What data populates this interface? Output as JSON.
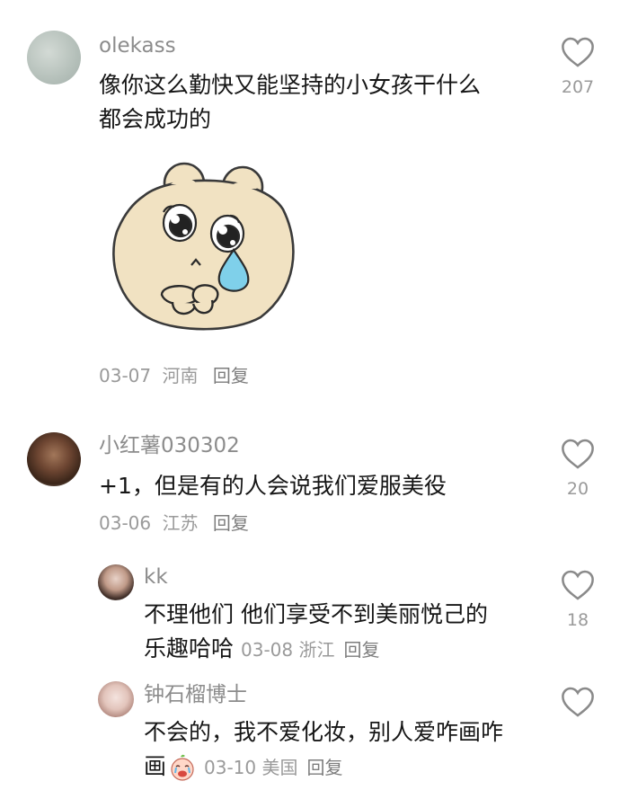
{
  "comments": [
    {
      "user": "olekass",
      "text_line1": "像你这么勤快又能坚持的小女孩干什么",
      "text_line2": "都会成功的",
      "date": "03-07",
      "location": "河南",
      "reply_label": "回复",
      "likes": "207",
      "sticker": "crying-bear-sticker"
    },
    {
      "user": "小红薯030302",
      "text": "+1，但是有的人会说我们爱服美役",
      "date": "03-06",
      "location": "江苏",
      "reply_label": "回复",
      "likes": "20"
    }
  ],
  "replies": [
    {
      "user": "kk",
      "text_line1": "不理他们 他们享受不到美丽悦己的",
      "text_line2": "乐趣哈哈",
      "date": "03-08",
      "location": "浙江",
      "reply_label": "回复",
      "likes": "18"
    },
    {
      "user": "钟石榴博士",
      "text_line1": "不会的，我不爱化妆，别人爱咋画咋",
      "text_line2": "画",
      "emoji": "crying-face-emoji",
      "date": "03-10",
      "location": "美国",
      "reply_label": "回复"
    }
  ],
  "colors": {
    "username": "#8c8c8c",
    "meta": "#9a9a9a",
    "text": "#161616",
    "heart": "#8a8a8a",
    "sticker_fill": "#f1e2c2",
    "tear": "#7fd0ea"
  }
}
